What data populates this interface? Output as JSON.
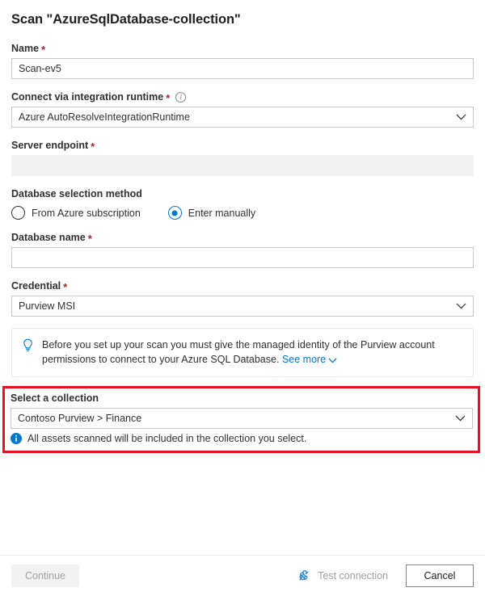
{
  "header": {
    "title": "Scan \"AzureSqlDatabase-collection\""
  },
  "fields": {
    "name": {
      "label": "Name",
      "required_mark": "*",
      "value": "Scan-ev5"
    },
    "integration_runtime": {
      "label": "Connect via integration runtime",
      "required_mark": "*",
      "info_icon": "info-circle-icon",
      "value": "Azure AutoResolveIntegrationRuntime"
    },
    "server_endpoint": {
      "label": "Server endpoint",
      "required_mark": "*",
      "value": "",
      "disabled": true
    },
    "database_selection_method": {
      "label": "Database selection method",
      "options": [
        {
          "label": "From Azure subscription",
          "selected": false
        },
        {
          "label": "Enter manually",
          "selected": true
        }
      ]
    },
    "database_name": {
      "label": "Database name",
      "required_mark": "*",
      "value": ""
    },
    "credential": {
      "label": "Credential",
      "required_mark": "*",
      "value": "Purview MSI"
    }
  },
  "banner": {
    "icon": "lightbulb-icon",
    "text": "Before you set up your scan you must give the managed identity of the Purview account permissions to connect to your Azure SQL Database.",
    "link_label": "See more",
    "link_chevron": "chevron-down-icon"
  },
  "collection": {
    "label": "Select a collection",
    "value": "Contoso Purview > Finance",
    "note_icon": "info-filled-icon",
    "note": "All assets scanned will be included in the collection you select.",
    "highlight_color": "#e81123"
  },
  "footer": {
    "continue_label": "Continue",
    "test_connection_label": "Test connection",
    "test_connection_icon": "plug-connector-icon",
    "cancel_label": "Cancel"
  },
  "colors": {
    "accent": "#0078d4",
    "required": "#a4262c",
    "highlight": "#e81123",
    "border": "#c8c6c4"
  }
}
